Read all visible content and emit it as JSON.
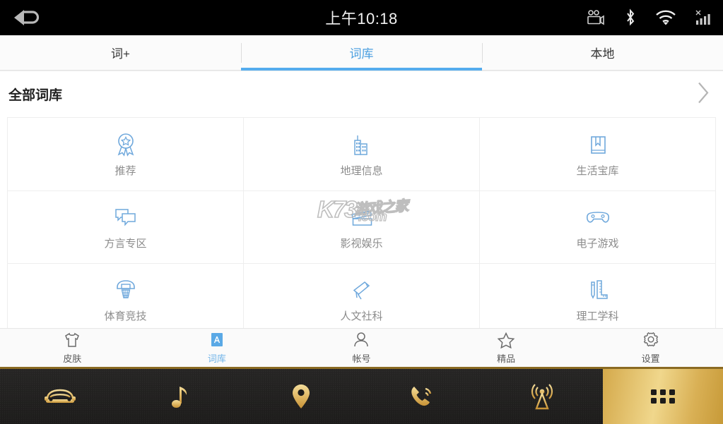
{
  "statusbar": {
    "time": "上午10:18",
    "back_icon": "back-arrow-icon",
    "icons": [
      {
        "name": "camera-video-icon"
      },
      {
        "name": "bluetooth-icon"
      },
      {
        "name": "wifi-icon"
      },
      {
        "name": "signal-bars-icon"
      }
    ]
  },
  "tabs": [
    {
      "label": "词+",
      "active": false
    },
    {
      "label": "词库",
      "active": true
    },
    {
      "label": "本地",
      "active": false
    }
  ],
  "section": {
    "title": "全部词库",
    "chevron_icon": "chevron-right-icon"
  },
  "grid": {
    "rows": [
      [
        {
          "label": "推荐",
          "icon": "award-ribbon-icon"
        },
        {
          "label": "地理信息",
          "icon": "city-buildings-icon"
        },
        {
          "label": "生活宝库",
          "icon": "book-bookmark-icon"
        }
      ],
      [
        {
          "label": "方言专区",
          "icon": "chat-bubbles-icon"
        },
        {
          "label": "影视娱乐",
          "icon": "clapperboard-icon"
        },
        {
          "label": "电子游戏",
          "icon": "game-controller-icon"
        }
      ],
      [
        {
          "label": "体育竞技",
          "icon": "basketball-hoop-icon"
        },
        {
          "label": "人文社科",
          "icon": "telescope-icon"
        },
        {
          "label": "理工学科",
          "icon": "pen-ruler-icon"
        }
      ]
    ]
  },
  "watermark": {
    "brand": "K73",
    "chinese": "游戏之家",
    "domain": ".com"
  },
  "bottomnav": [
    {
      "label": "皮肤",
      "icon": "tshirt-icon",
      "active": false
    },
    {
      "label": "词库",
      "icon": "dictionary-a-icon",
      "active": true
    },
    {
      "label": "帐号",
      "icon": "person-icon",
      "active": false
    },
    {
      "label": "精品",
      "icon": "star-icon",
      "active": false
    },
    {
      "label": "设置",
      "icon": "gear-icon",
      "active": false
    }
  ],
  "dock": [
    {
      "icon": "car-icon",
      "active": false
    },
    {
      "icon": "music-note-icon",
      "active": false
    },
    {
      "icon": "location-pin-icon",
      "active": false
    },
    {
      "icon": "phone-call-icon",
      "active": false
    },
    {
      "icon": "radio-tower-icon",
      "active": false
    },
    {
      "icon": "apps-grid-icon",
      "active": true
    }
  ],
  "colors": {
    "accent_blue": "#55acee",
    "icon_blue": "#6fa8dc",
    "gold": "#d9b055",
    "statusbar_bg": "#000000"
  }
}
